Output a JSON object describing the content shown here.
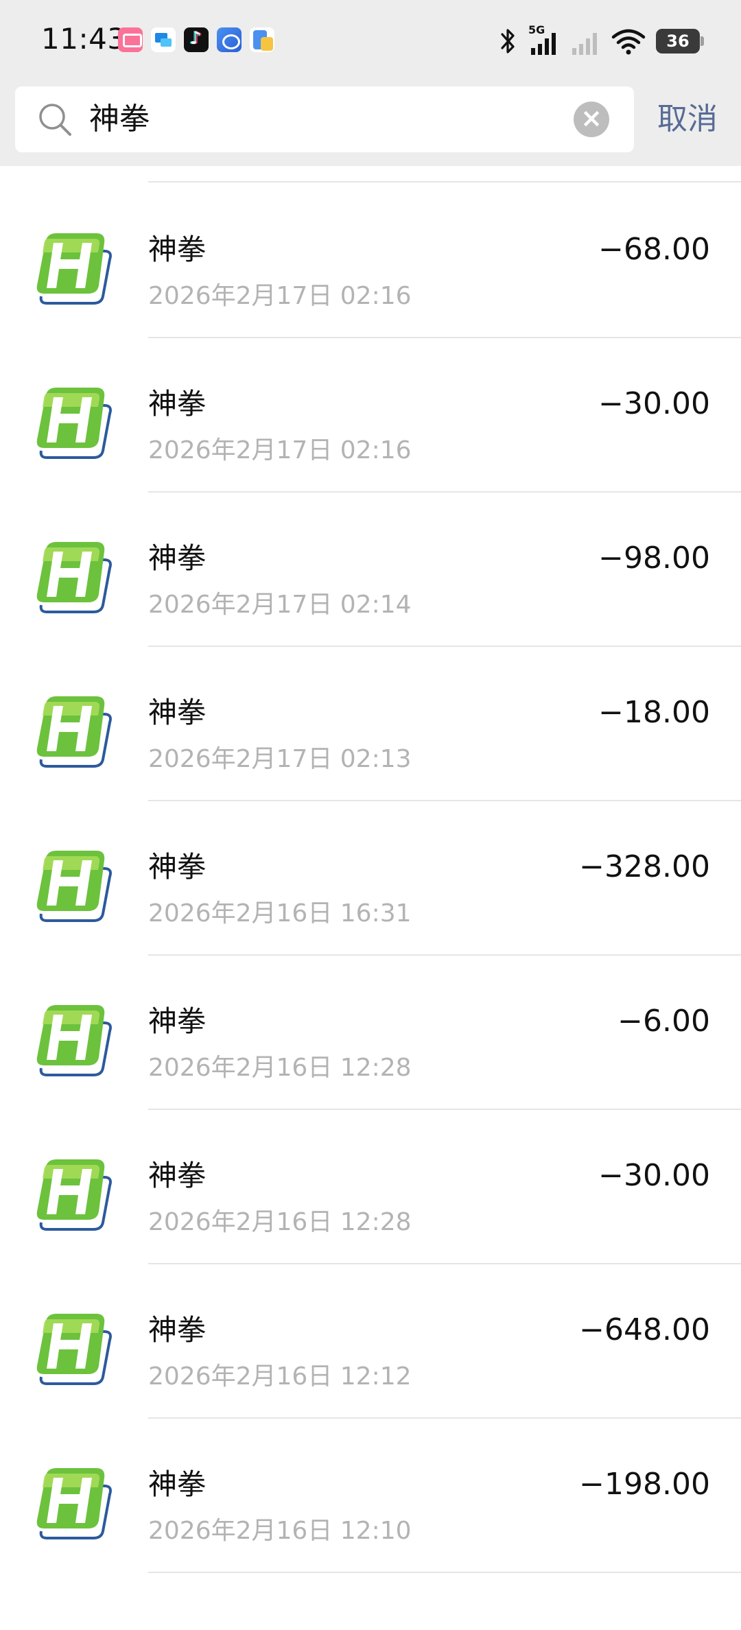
{
  "status_bar": {
    "time": "11:43",
    "network_label": "5G",
    "battery_level": "36",
    "app_icons": [
      "bilibili-icon",
      "message-icon",
      "tiktok-icon",
      "browser-icon",
      "file-icon"
    ]
  },
  "search": {
    "query": "神拳",
    "cancel_label": "取消",
    "clear_symbol": "×"
  },
  "transactions": [
    {
      "name": "神拳",
      "time": "2026年2月17日 02:16",
      "amount": "−68.00"
    },
    {
      "name": "神拳",
      "time": "2026年2月17日 02:16",
      "amount": "−30.00"
    },
    {
      "name": "神拳",
      "time": "2026年2月17日 02:14",
      "amount": "−98.00"
    },
    {
      "name": "神拳",
      "time": "2026年2月17日 02:13",
      "amount": "−18.00"
    },
    {
      "name": "神拳",
      "time": "2026年2月16日 16:31",
      "amount": "−328.00"
    },
    {
      "name": "神拳",
      "time": "2026年2月16日 12:28",
      "amount": "−6.00"
    },
    {
      "name": "神拳",
      "time": "2026年2月16日 12:28",
      "amount": "−30.00"
    },
    {
      "name": "神拳",
      "time": "2026年2月16日 12:12",
      "amount": "−648.00"
    },
    {
      "name": "神拳",
      "time": "2026年2月16日 12:10",
      "amount": "−198.00"
    }
  ],
  "colors": {
    "logo_green_light": "#9ed94a",
    "logo_green_dark": "#3a9a2e",
    "logo_blue": "#2c5a9c",
    "link_blue": "#576b95",
    "meta_gray": "#b3b3b3"
  }
}
